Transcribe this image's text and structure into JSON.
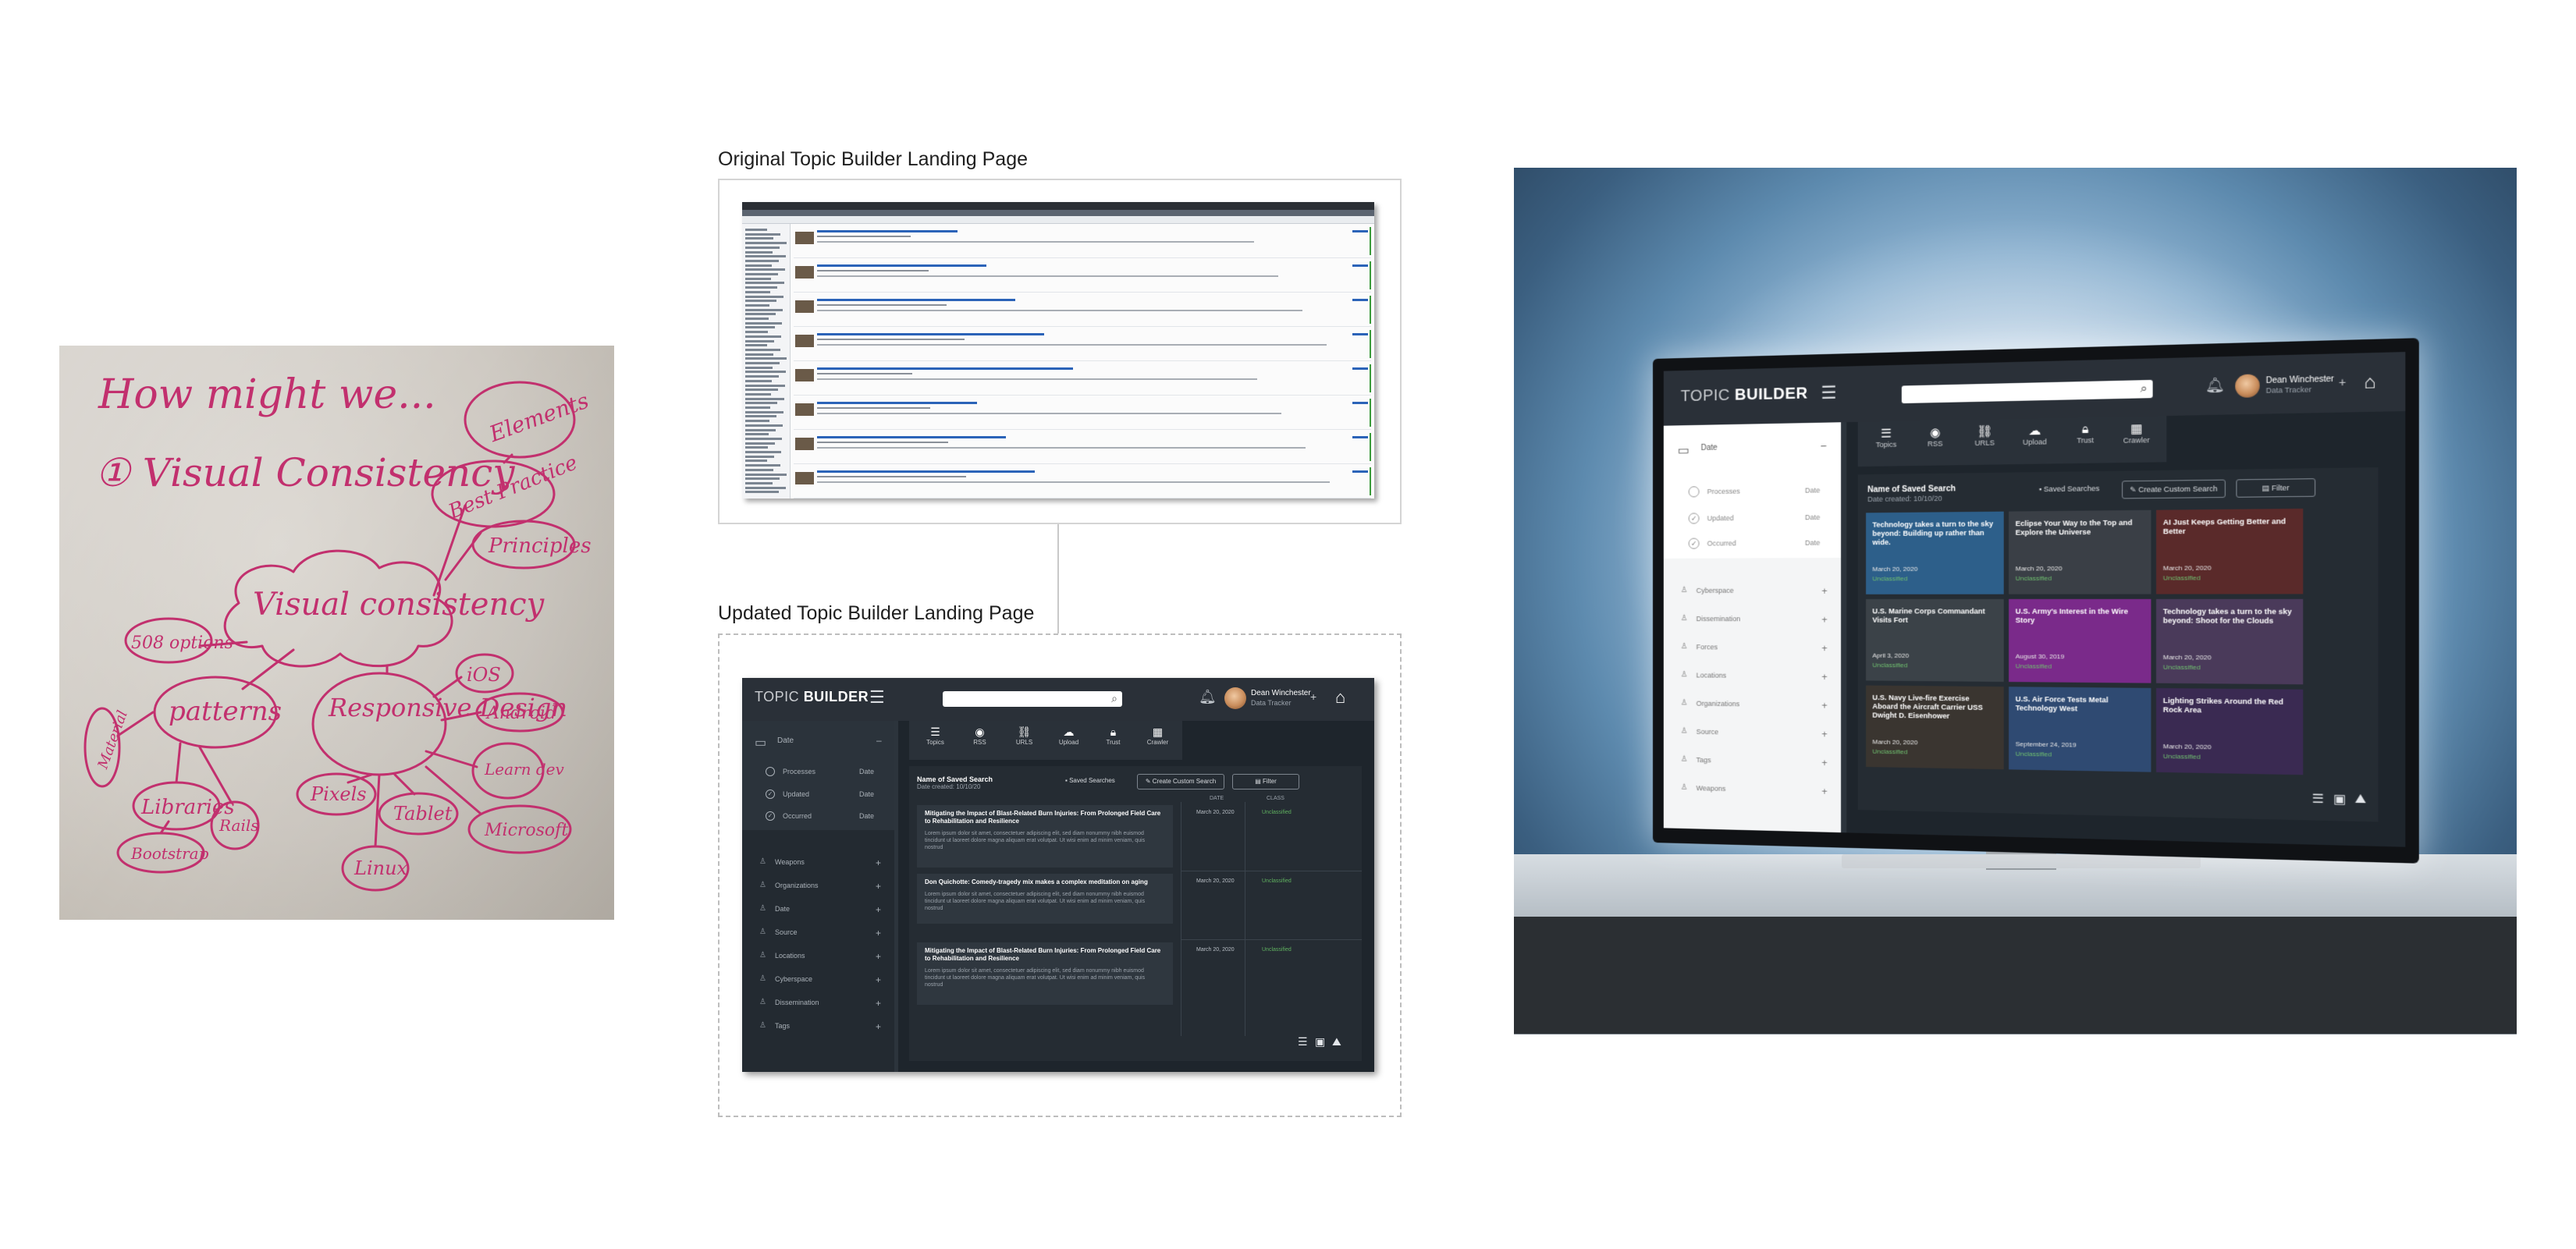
{
  "captions": {
    "original": "Original Topic Builder Landing Page",
    "updated": "Updated Topic Builder Landing Page"
  },
  "whiteboard": {
    "heading": "How might we...",
    "goal": "① Visual Consistency",
    "center": "Visual consistency",
    "nodes": [
      "Elements",
      "Best Practice",
      "Principles",
      "508 options",
      "patterns",
      "Responsive Design",
      "iOS",
      "Android",
      "Libraries",
      "Rails",
      "Bootstrap",
      "Material",
      "Learn dev",
      "Pixels",
      "Tablet",
      "Microsoft",
      "Linux"
    ]
  },
  "app": {
    "brand_light": "TOPIC ",
    "brand_bold": "BUILDER",
    "user_name": "Dean Winchester",
    "user_role": "Data Tracker",
    "tabs": [
      "Topics",
      "RSS",
      "URLS",
      "Upload",
      "Trust",
      "Crawler"
    ],
    "saved_search_title": "Name of Saved Search",
    "saved_search_date": "Date created: 10/10/20",
    "saved_searches_btn": "Saved Searches",
    "create_custom_btn": "Create Custom Search",
    "filter_btn": "Filter",
    "date_group": "Date",
    "date_filters": [
      {
        "label": "Processes",
        "right": "Date"
      },
      {
        "label": "Updated",
        "right": "Date"
      },
      {
        "label": "Occurred",
        "right": "Date"
      }
    ],
    "col_date": "DATE",
    "col_class": "CLASS",
    "results": [
      {
        "title": "Mitigating the Impact of Blast-Related Burn Injuries: From Prolonged Field Care to Rehabilitation and Resilience",
        "body": "Lorem ipsum dolor sit amet, consectetuer adipiscing elit, sed diam nonummy nibh euismod tincidunt ut laoreet dolore magna aliquam erat volutpat. Ut wisi enim ad minim veniam, quis nostrud",
        "date": "March 20, 2020",
        "class": "Unclassified"
      },
      {
        "title": "Don Quichotte: Comedy-tragedy mix makes a complex meditation on aging",
        "body": "Lorem ipsum dolor sit amet, consectetuer adipiscing elit, sed diam nonummy nibh euismod tincidunt ut laoreet dolore magna aliquam erat volutpat. Ut wisi enim ad minim veniam, quis nostrud",
        "date": "March 20, 2020",
        "class": "Unclassified"
      },
      {
        "title": "Mitigating the Impact of Blast-Related Burn Injuries: From Prolonged Field Care to Rehabilitation and Resilience",
        "body": "Lorem ipsum dolor sit amet, consectetuer adipiscing elit, sed diam nonummy nibh euismod tincidunt ut laoreet dolore magna aliquam erat volutpat. Ut wisi enim ad minim veniam, quis nostrud",
        "date": "March 20, 2020",
        "class": "Unclassified"
      }
    ],
    "facets_updated": [
      "Weapons",
      "Organizations",
      "Date",
      "Source",
      "Locations",
      "Cyberspace",
      "Dissemination",
      "Tags"
    ],
    "facets_monitor": [
      "Cyberspace",
      "Dissemination",
      "Forces",
      "Locations",
      "Organizations",
      "Source",
      "Tags",
      "Weapons"
    ],
    "tiles": [
      {
        "title": "Technology takes a turn to the sky beyond: Building up rather than wide.",
        "date": "March 20, 2020",
        "class": "Unclassified",
        "bg": "#2d5f8a"
      },
      {
        "title": "Eclipse Your Way to the Top and Explore the Universe",
        "date": "March 20, 2020",
        "class": "Unclassified",
        "bg": "#3a3f46"
      },
      {
        "title": "AI Just Keeps Getting Better and Better",
        "date": "March 20, 2020",
        "class": "Unclassified",
        "bg": "#5a2a2a"
      },
      {
        "title": "U.S. Marine Corps Commandant Visits Fort",
        "date": "April 3, 2020",
        "class": "Unclassified",
        "bg": "#3b4248"
      },
      {
        "title": "U.S. Army's Interest in the Wire Story",
        "date": "August 30, 2019",
        "class": "Unclassified",
        "bg": "#7a2a8a"
      },
      {
        "title": "Technology takes a turn to the sky beyond: Shoot for the Clouds",
        "date": "March 20, 2020",
        "class": "Unclassified",
        "bg": "#4a3a5a"
      },
      {
        "title": "U.S. Navy Live-fire Exercise Aboard the Aircraft Carrier USS Dwight D. Eisenhower",
        "date": "March 20, 2020",
        "class": "Unclassified",
        "bg": "#3a3530"
      },
      {
        "title": "U.S. Air Force Tests Metal Technology West",
        "date": "September 24, 2019",
        "class": "Unclassified",
        "bg": "#2f4a72"
      },
      {
        "title": "Lighting Strikes Around the Red Rock Area",
        "date": "March 20, 2020",
        "class": "Unclassified",
        "bg": "#3a2a52"
      }
    ]
  }
}
